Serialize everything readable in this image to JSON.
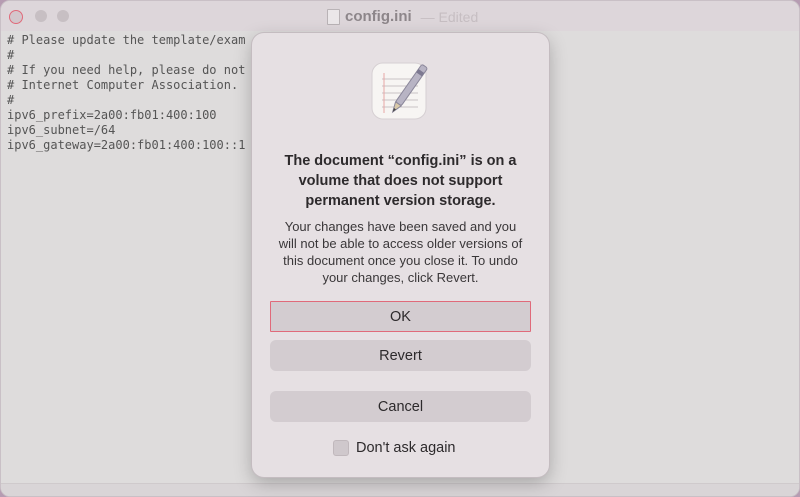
{
  "window": {
    "title": "config.ini",
    "status": "— Edited"
  },
  "editor": {
    "lines": [
      "# Please update the template/exam",
      "#",
      "# If you need help, please do not",
      "# Internet Computer Association.",
      "#",
      "ipv6_prefix=2a00:fb01:400:100",
      "ipv6_subnet=/64",
      "ipv6_gateway=2a00:fb01:400:100::1"
    ]
  },
  "dialog": {
    "icon": "textedit-app-icon",
    "headline": "The document “config.ini” is on a volume that does not support permanent version storage.",
    "message": "Your changes have been saved and you will not be able to access older versions of this document once you close it. To undo your changes, click Revert.",
    "ok_label": "OK",
    "revert_label": "Revert",
    "cancel_label": "Cancel",
    "checkbox_label": "Don't ask again",
    "checkbox_checked": false
  },
  "colors": {
    "desktop": "#b69cb2",
    "focus_ring": "#e06a7a"
  }
}
